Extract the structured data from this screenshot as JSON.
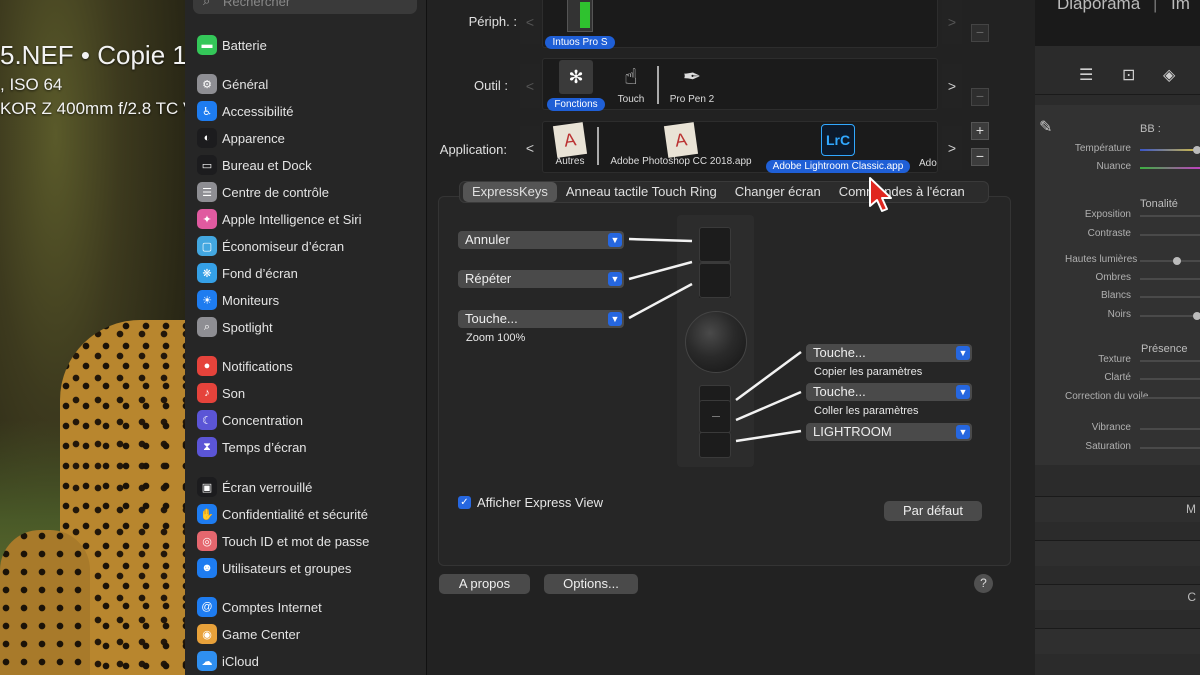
{
  "photo_overlay": {
    "filename": "5.NEF  •  Copie 1",
    "exposure": ", ISO 64",
    "lens": "KOR Z 400mm f/2.8 TC V"
  },
  "sidebar": {
    "search_placeholder": "Rechercher",
    "items": [
      {
        "label": "Batterie",
        "icon": "battery-icon",
        "color": "#34c759"
      },
      {
        "label": "Général",
        "icon": "gear-icon",
        "color": "#8e8e93"
      },
      {
        "label": "Accessibilité",
        "icon": "accessibility-icon",
        "color": "#1e7cf0"
      },
      {
        "label": "Apparence",
        "icon": "appearance-icon",
        "color": "#1c1c1e"
      },
      {
        "label": "Bureau et Dock",
        "icon": "dock-icon",
        "color": "#1c1c1e"
      },
      {
        "label": "Centre de contrôle",
        "icon": "control-center-icon",
        "color": "#8e8e93"
      },
      {
        "label": "Apple Intelligence et Siri",
        "icon": "siri-icon",
        "color": "#e05aa0"
      },
      {
        "label": "Économiseur d’écran",
        "icon": "screensaver-icon",
        "color": "#43a7e0"
      },
      {
        "label": "Fond d’écran",
        "icon": "wallpaper-icon",
        "color": "#35a0e6"
      },
      {
        "label": "Moniteurs",
        "icon": "displays-icon",
        "color": "#1e7cf0"
      },
      {
        "label": "Spotlight",
        "icon": "spotlight-icon",
        "color": "#8e8e93"
      },
      {
        "label": "Notifications",
        "icon": "notifications-icon",
        "color": "#e5433b"
      },
      {
        "label": "Son",
        "icon": "sound-icon",
        "color": "#e5433b"
      },
      {
        "label": "Concentration",
        "icon": "focus-icon",
        "color": "#5b55d6"
      },
      {
        "label": "Temps d’écran",
        "icon": "screen-time-icon",
        "color": "#5b55d6"
      },
      {
        "label": "Écran verrouillé",
        "icon": "lock-screen-icon",
        "color": "#1c1c1e"
      },
      {
        "label": "Confidentialité et sécurité",
        "icon": "privacy-hand-icon",
        "color": "#1e7cf0"
      },
      {
        "label": "Touch ID et mot de passe",
        "icon": "fingerprint-icon",
        "color": "#e5676e"
      },
      {
        "label": "Utilisateurs et groupes",
        "icon": "users-icon",
        "color": "#1e7cf0"
      },
      {
        "label": "Comptes Internet",
        "icon": "at-icon",
        "color": "#1e7cf0"
      },
      {
        "label": "Game Center",
        "icon": "game-center-icon",
        "color": "#e8a13a"
      },
      {
        "label": "iCloud",
        "icon": "icloud-icon",
        "color": "#2f8ff0"
      }
    ]
  },
  "wacom": {
    "device_label": "Périph. :",
    "device_name": "Intuos Pro S",
    "tool_label": "Outil :",
    "tools": [
      "Fonctions",
      "Touch",
      "Pro Pen 2"
    ],
    "app_label": "Application:",
    "apps": [
      "Autres",
      "Adobe Photoshop CC 2018.app",
      "Adobe Lightroom Classic.app",
      "Ado"
    ],
    "lrc_badge": "LrC",
    "tabs": [
      "ExpressKeys",
      "Anneau tactile Touch Ring",
      "Changer écran",
      "Commandes à l'écran"
    ],
    "left_keys": [
      {
        "value": "Annuler",
        "sub": ""
      },
      {
        "value": "Répéter",
        "sub": ""
      },
      {
        "value": "Touche...",
        "sub": "Zoom 100%"
      }
    ],
    "right_keys": [
      {
        "value": "Touche...",
        "sub": "Copier les paramètres"
      },
      {
        "value": "Touche...",
        "sub": "Coller les paramètres"
      },
      {
        "value": "LIGHTROOM",
        "sub": ""
      }
    ],
    "express_view_label": "Afficher Express View",
    "express_view_checked": true,
    "default_button": "Par défaut",
    "about_button": "A propos",
    "options_button": "Options...",
    "help": "?"
  },
  "lightroom": {
    "modules": [
      "Diaporama",
      "|",
      "Im"
    ],
    "basic": {
      "wb_label": "BB :",
      "temperature": "Température",
      "tint": "Nuance",
      "tone_header": "Tonalité",
      "tone": [
        "Exposition",
        "Contraste",
        "Hautes lumières",
        "Ombres",
        "Blancs",
        "Noirs"
      ],
      "presence_header": "Présence",
      "presence": [
        "Texture",
        "Clarté",
        "Correction du voile",
        "Vibrance",
        "Saturation"
      ]
    },
    "collapsed_panels": [
      "M",
      "C"
    ]
  }
}
